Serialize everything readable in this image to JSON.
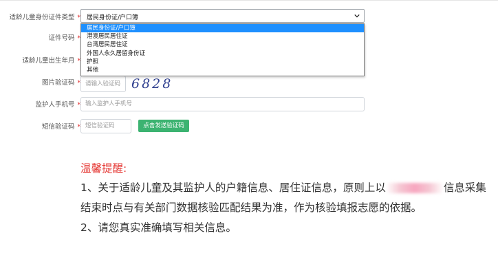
{
  "form": {
    "child_id_type": {
      "label": "适龄儿童身份证件类型",
      "required_mark": "*",
      "selected": "居民身份证/户口簿",
      "options": [
        "居民身份证/户口簿",
        "港澳居民居住证",
        "台湾居民居住证",
        "外国人永久居留身份证",
        "护照",
        "其他"
      ]
    },
    "id_number": {
      "label": "证件号码",
      "required_mark": "*"
    },
    "child_birthdate": {
      "label": "适龄儿童出生年月",
      "required_mark": "*"
    },
    "image_captcha": {
      "label": "图片验证码",
      "required_mark": "*",
      "placeholder": "请输入验证码",
      "captcha_text": "6828"
    },
    "guardian_phone": {
      "label": "监护人手机号",
      "required_mark": "*",
      "placeholder": "输入监护人手机号"
    },
    "sms_code": {
      "label": "短信验证码",
      "required_mark": "*",
      "placeholder": "短信验证码",
      "send_button": "点击发送验证码"
    }
  },
  "tips": {
    "title": "温馨提醒:",
    "line1_before": "1、关于适龄儿童及其监护人的户籍信息、居住证信息，原则上以",
    "line1_after": "信息采集结束时点与有关部门数据核验匹配结果为准，作为核验填报志愿的依据。",
    "line2": "2、请您真实准确填写相关信息。"
  }
}
